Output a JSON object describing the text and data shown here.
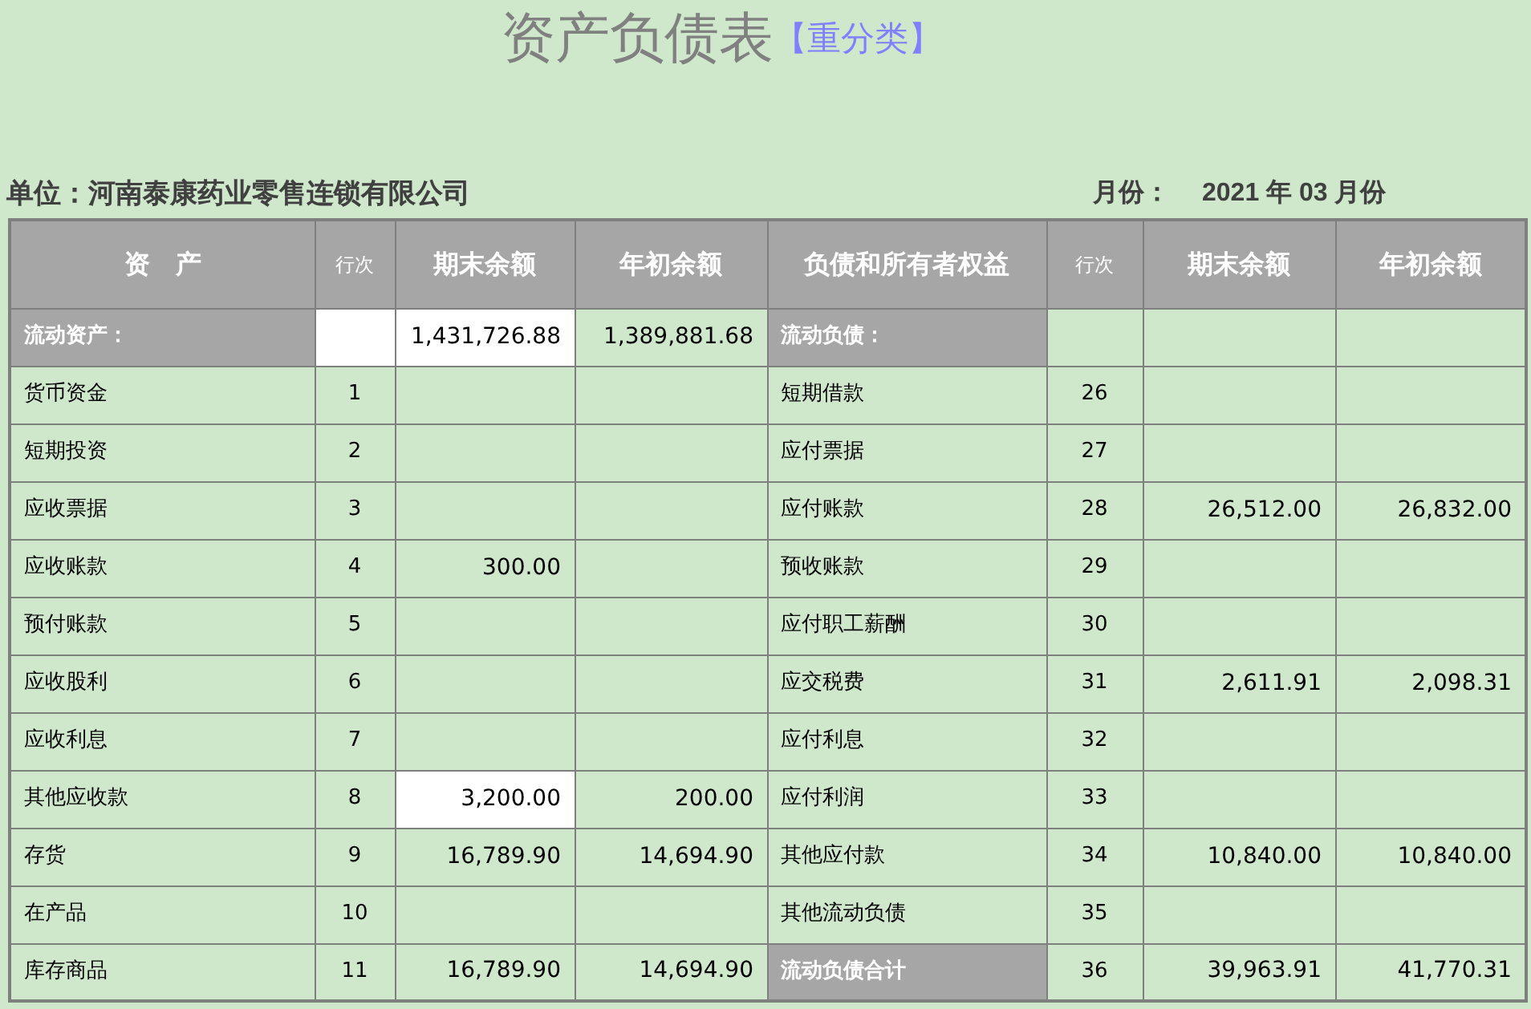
{
  "title": "资产负债表",
  "subtitle": "【重分类】",
  "unit": {
    "label": "单位：",
    "value": "河南泰康药业零售连锁有限公司"
  },
  "period": {
    "label": "月份：",
    "value": "2021 年 03 月份"
  },
  "table": {
    "columns": [
      "资　产",
      "行次",
      "期末余额",
      "年初余额",
      "负债和所有者权益",
      "行次",
      "期末余额",
      "年初余额"
    ],
    "rows": [
      {
        "left": {
          "kind": "heading",
          "label": "流动资产：",
          "end": "1,431,726.88",
          "begin": "1,389,881.68",
          "line_highlighted": true,
          "end_highlighted": true
        },
        "right": {
          "kind": "heading",
          "label": "流动负债："
        }
      },
      {
        "left": {
          "kind": "item",
          "label": "货币资金",
          "line": "1"
        },
        "right": {
          "kind": "item",
          "label": "短期借款",
          "line": "26"
        }
      },
      {
        "left": {
          "kind": "item",
          "label": "短期投资",
          "line": "2"
        },
        "right": {
          "kind": "item",
          "label": "应付票据",
          "line": "27"
        }
      },
      {
        "left": {
          "kind": "item",
          "label": "应收票据",
          "line": "3"
        },
        "right": {
          "kind": "item",
          "label": "应付账款",
          "line": "28",
          "end": "26,512.00",
          "begin": "26,832.00"
        }
      },
      {
        "left": {
          "kind": "item",
          "label": "应收账款",
          "line": "4",
          "end": "300.00"
        },
        "right": {
          "kind": "item",
          "label": "预收账款",
          "line": "29"
        }
      },
      {
        "left": {
          "kind": "item",
          "label": "预付账款",
          "line": "5"
        },
        "right": {
          "kind": "item",
          "label": "应付职工薪酬",
          "line": "30"
        }
      },
      {
        "left": {
          "kind": "item",
          "label": "应收股利",
          "line": "6"
        },
        "right": {
          "kind": "item",
          "label": "应交税费",
          "line": "31",
          "end": "2,611.91",
          "begin": "2,098.31"
        }
      },
      {
        "left": {
          "kind": "item",
          "label": "应收利息",
          "line": "7"
        },
        "right": {
          "kind": "item",
          "label": "应付利息",
          "line": "32"
        }
      },
      {
        "left": {
          "kind": "item",
          "label": "其他应收款",
          "line": "8",
          "end": "3,200.00",
          "begin": "200.00",
          "end_highlighted": true
        },
        "right": {
          "kind": "item",
          "label": "应付利润",
          "line": "33"
        }
      },
      {
        "left": {
          "kind": "item",
          "label": "存货",
          "line": "9",
          "end": "16,789.90",
          "begin": "14,694.90"
        },
        "right": {
          "kind": "item",
          "label": "其他应付款",
          "line": "34",
          "end": "10,840.00",
          "begin": "10,840.00"
        }
      },
      {
        "left": {
          "kind": "item",
          "label": "在产品",
          "line": "10"
        },
        "right": {
          "kind": "item",
          "label": "其他流动负债",
          "line": "35"
        }
      },
      {
        "left": {
          "kind": "item",
          "label": "库存商品",
          "line": "11",
          "end": "16,789.90",
          "begin": "14,694.90"
        },
        "right": {
          "kind": "heading",
          "label": "流动负债合计",
          "line": "36",
          "end": "39,963.91",
          "begin": "41,770.31"
        }
      }
    ]
  }
}
